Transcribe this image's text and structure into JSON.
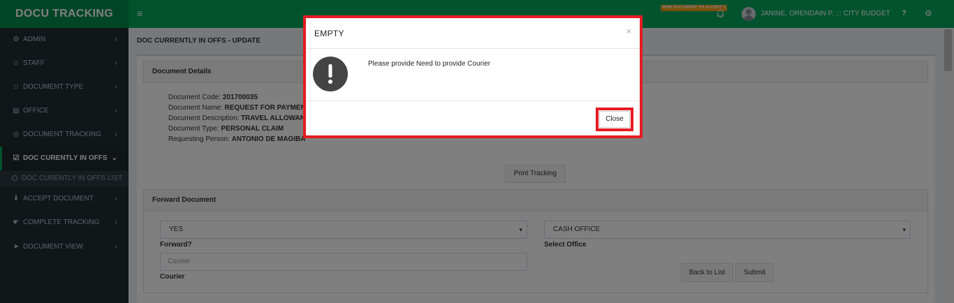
{
  "app": {
    "logo": "DOCU TRACKING"
  },
  "header": {
    "menu_icon": "≡",
    "notification_badge": "NEW DOCUMENT TO ACCEPT 1",
    "user_name": "JANINE, ORENDAIN P. ::: CITY BUDGET",
    "help": "?",
    "settings_icon": "⚙"
  },
  "sidebar": {
    "items": [
      {
        "label": "ADMIN",
        "icon": "⚙"
      },
      {
        "label": "STAFF",
        "icon": "☺"
      },
      {
        "label": "DOCUMENT TYPE",
        "icon": "□"
      },
      {
        "label": "OFFICE",
        "icon": "▤"
      },
      {
        "label": "DOCUMENT TRACKING",
        "icon": "◎"
      },
      {
        "label": "DOC CURENTLY IN OFFS",
        "icon": "☑"
      },
      {
        "label": "ACCEPT DOCUMENT",
        "icon": "⬇"
      },
      {
        "label": "COMPLETE TRACKING",
        "icon": "☛"
      },
      {
        "label": "DOCUMENT VIEW",
        "icon": "➤"
      }
    ],
    "sub_item": "DOC CURENTLY IN OFFS LIST",
    "chevron": "‹",
    "chevron_open": "⌄"
  },
  "page": {
    "title": "DOC CURRENTLY IN OFFS - UPDATE"
  },
  "details": {
    "header": "Document Details",
    "rows": [
      {
        "label": "Document Code:",
        "value": "201700035"
      },
      {
        "label": "Document Name:",
        "value": "REQUEST FOR PAYMENT"
      },
      {
        "label": "Document Description:",
        "value": "TRAVEL ALLOWANCE"
      },
      {
        "label": "Document Type:",
        "value": "PERSONAL CLAIM"
      },
      {
        "label": "Requesting Person:",
        "value": "ANTONIO DE MAGIBA"
      }
    ],
    "print_button": "Print Tracking"
  },
  "forward": {
    "header": "Forward Document",
    "forward_value": "YES",
    "forward_label": "Forward?",
    "office_value": "CASH OFFICE",
    "office_label": "Select Office",
    "courier_placeholder": "Courier",
    "courier_label": "Courier",
    "back_button": "Back to List",
    "submit_button": "Submit",
    "caret": "▾"
  },
  "modal": {
    "title": "EMPTY",
    "close_x": "×",
    "message": "Please provide Need to provide Courier",
    "close_button": "Close"
  },
  "colors": {
    "header_green": "#00a65a",
    "logo_green": "#008d4c",
    "sidebar_bg": "#222d32",
    "highlight_red": "#e51c23"
  }
}
